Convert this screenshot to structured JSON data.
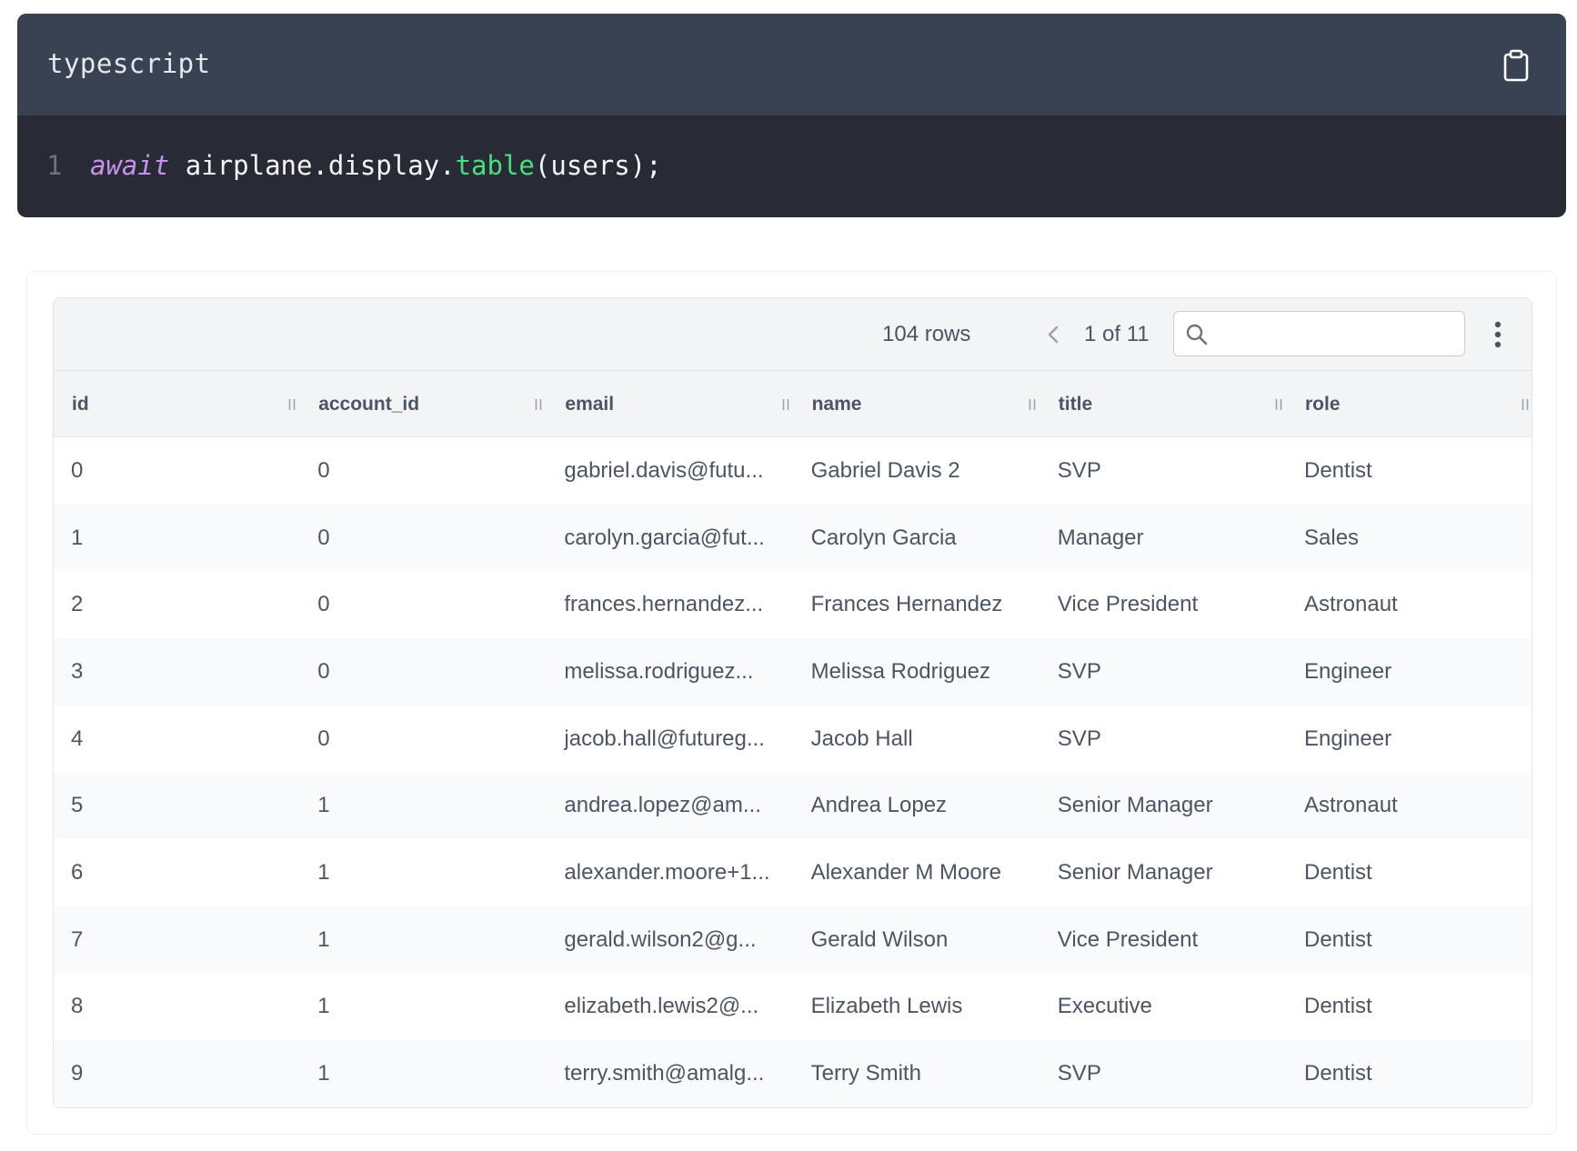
{
  "code": {
    "language": "typescript",
    "line_number": "1",
    "keyword": "await",
    "object": " airplane.display.",
    "method": "table",
    "args": "(users);",
    "copy_icon": "clipboard-icon"
  },
  "toolbar": {
    "row_count": "104 rows",
    "page_info": "1 of 11",
    "search_value": "",
    "search_placeholder": ""
  },
  "table": {
    "columns": [
      "id",
      "account_id",
      "email",
      "name",
      "title",
      "role"
    ],
    "rows": [
      [
        "0",
        "0",
        "gabriel.davis@futu...",
        "Gabriel Davis 2",
        "SVP",
        "Dentist"
      ],
      [
        "1",
        "0",
        "carolyn.garcia@fut...",
        "Carolyn Garcia",
        "Manager",
        "Sales"
      ],
      [
        "2",
        "0",
        "frances.hernandez...",
        "Frances Hernandez",
        "Vice President",
        "Astronaut"
      ],
      [
        "3",
        "0",
        "melissa.rodriguez...",
        "Melissa Rodriguez",
        "SVP",
        "Engineer"
      ],
      [
        "4",
        "0",
        "jacob.hall@futureg...",
        "Jacob Hall",
        "SVP",
        "Engineer"
      ],
      [
        "5",
        "1",
        "andrea.lopez@am...",
        "Andrea Lopez",
        "Senior Manager",
        "Astronaut"
      ],
      [
        "6",
        "1",
        "alexander.moore+1...",
        "Alexander M Moore",
        "Senior Manager",
        "Dentist"
      ],
      [
        "7",
        "1",
        "gerald.wilson2@g...",
        "Gerald Wilson",
        "Vice President",
        "Dentist"
      ],
      [
        "8",
        "1",
        "elizabeth.lewis2@...",
        "Elizabeth Lewis",
        "Executive",
        "Dentist"
      ],
      [
        "9",
        "1",
        "terry.smith@amalg...",
        "Terry Smith",
        "SVP",
        "Dentist"
      ]
    ]
  }
}
